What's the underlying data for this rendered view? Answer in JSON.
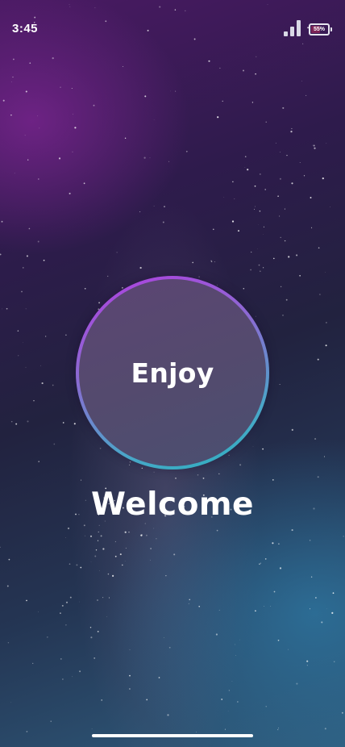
{
  "status_bar": {
    "time": "3:45",
    "signal_icon": "cellular-signal-icon",
    "battery_icon": "battery-icon",
    "battery_percent_label": "55%",
    "battery_level": 0.55
  },
  "main": {
    "enjoy_button_label": "Enjoy",
    "welcome_title": "Welcome"
  },
  "colors": {
    "ring_gradient_start": "#b13ee0",
    "ring_gradient_end": "#2ab2bf",
    "button_fill": "#544a6e",
    "battery_fill": "#7d2356",
    "text": "#ffffff"
  },
  "home_indicator": "home-indicator-bar"
}
